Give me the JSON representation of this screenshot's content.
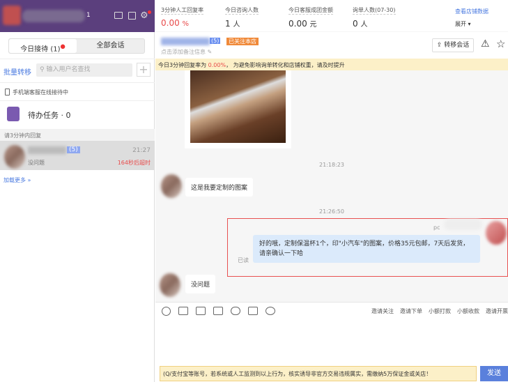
{
  "sidebar": {
    "badge_count": "1",
    "tabs": [
      {
        "label": "今日接待 (1)"
      },
      {
        "label": "全部会话"
      }
    ],
    "batch_transfer": "批量转移",
    "search_placeholder": "输入用户名查找",
    "mobile_status": "手机端客服在线接待中",
    "todo": "待办任务 · 0",
    "section_label": "请3分钟内回复",
    "conversations": [
      {
        "name_suffix": "(5)",
        "time": "21:27",
        "preview": "没问题",
        "timeout": "164秒后超时"
      }
    ],
    "load_more": "加载更多 »"
  },
  "stats": [
    {
      "label": "3分钟人工回复率",
      "value": "0.00",
      "unit": "%"
    },
    {
      "label": "今日咨询人数",
      "value": "1",
      "unit": "人"
    },
    {
      "label": "今日客服成团金额",
      "value": "0.00",
      "unit": "元"
    },
    {
      "label": "询单人数(07-30)",
      "value": "0",
      "unit": "人"
    }
  ],
  "stats_link": "查看店铺数据",
  "expand": "展开 ▾",
  "contact": {
    "name_suffix": "(5)",
    "follow_badge": "已关注本店",
    "note_hint": "点击添加备注信息",
    "transfer_button": "转移会话"
  },
  "banner": {
    "prefix": "今日3分钟回复率为 ",
    "rate": "0.00%",
    "suffix": "， 为避免影响询单转化和店铺权重，请及时提升"
  },
  "messages": [
    {
      "time": "21:18:23",
      "text": "这是我要定制的图案"
    },
    {
      "time": "21:26:50",
      "sender": "pc",
      "text": "好的哦，定制保温杯1个，印\"小汽车\"的图案，价格35元包邮，7天后发货，请亲确认一下哈",
      "read": "已读"
    },
    {
      "text": "没问题"
    }
  ],
  "toolbar_actions": [
    "邀请关注",
    "邀请下单",
    "小额打款",
    "小额收款",
    "邀请开票"
  ],
  "warning": "(Q/支付宝等账号，若系统或人工监测到以上行为，核实诱导非官方交易违规属实，需缴纳5万保证金或关店！",
  "send": "发送",
  "colors": {
    "accent": "#5b3f7d",
    "primary": "#4a7ae0",
    "alert": "#e84a4a",
    "highlight": "#e84a4a"
  }
}
